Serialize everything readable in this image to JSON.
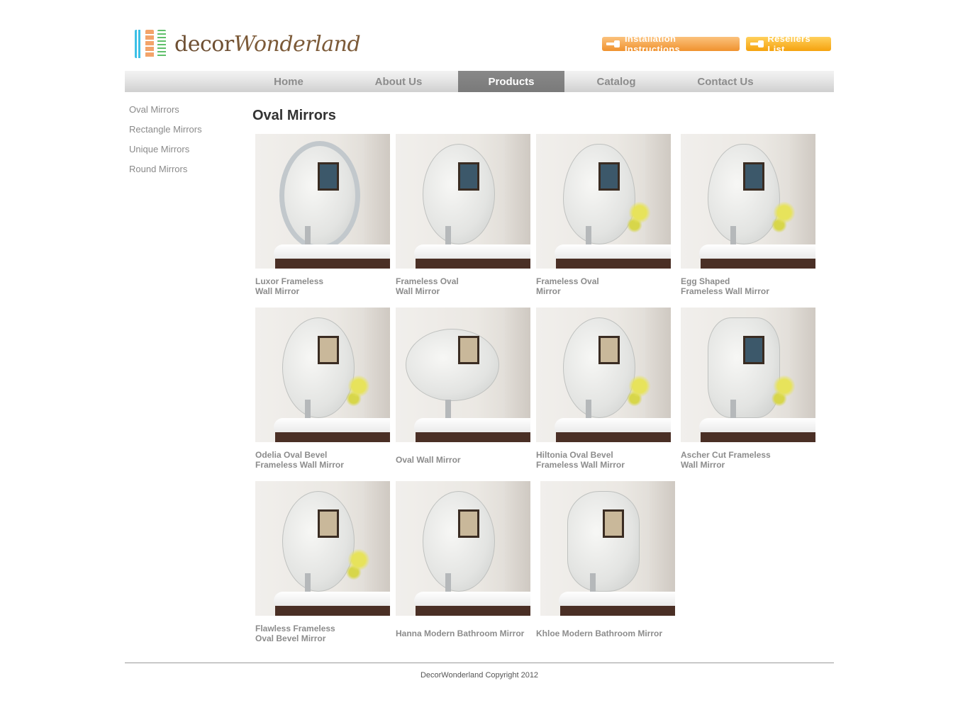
{
  "header": {
    "logo_prefix": "decor",
    "logo_script": "Wonderland",
    "buttons": {
      "installation": "Installation Instructions",
      "resellers": "Resellers List"
    }
  },
  "nav": [
    "Home",
    "About Us",
    "Products",
    "Catalog",
    "Contact Us"
  ],
  "nav_active": "Products",
  "sidebar": [
    "Oval Mirrors",
    "Rectangle Mirrors",
    "Unique Mirrors",
    "Round Mirrors"
  ],
  "page_title": "Oval Mirrors",
  "products": [
    {
      "line1": "Luxor Frameless",
      "line2": "Wall Mirror"
    },
    {
      "line1": "Frameless Oval",
      "line2": "Wall Mirror"
    },
    {
      "line1": "Frameless Oval",
      "line2": "Mirror"
    },
    {
      "line1": "Egg Shaped",
      "line2": "Frameless Wall  Mirror"
    },
    {
      "line1": "Odelia Oval Bevel",
      "line2": "Frameless Wall Mirror"
    },
    {
      "line1": "Oval Wall Mirror",
      "line2": ""
    },
    {
      "line1": "Hiltonia Oval Bevel",
      "line2": "Frameless Wall Mirror"
    },
    {
      "line1": "Ascher Cut Frameless",
      "line2": "Wall Mirror"
    },
    {
      "line1": "Flawless Frameless",
      "line2": "Oval Bevel Mirror"
    },
    {
      "line1": "Hanna Modern Bathroom Mirror",
      "line2": ""
    },
    {
      "line1": "Khloe Modern Bathroom Mirror",
      "line2": ""
    }
  ],
  "footer": "DecorWonderland Copyright 2012",
  "colors": {
    "accent_orange": "#f0922e",
    "accent_yellow": "#f5a20e",
    "nav_active_bg": "#808080",
    "text_gray": "#8c8c8c"
  }
}
